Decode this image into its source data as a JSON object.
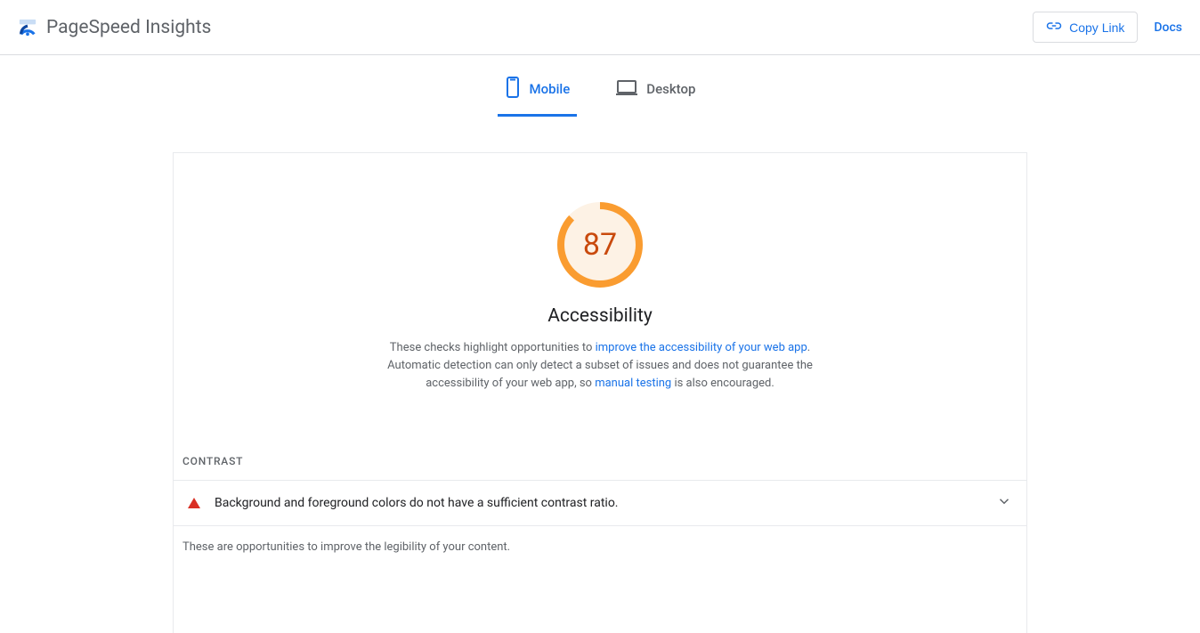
{
  "header": {
    "title": "PageSpeed Insights",
    "copy_link_label": "Copy Link",
    "docs_label": "Docs"
  },
  "tabs": {
    "mobile": "Mobile",
    "desktop": "Desktop"
  },
  "gauge": {
    "score": "87",
    "title": "Accessibility",
    "desc_part1": "These checks highlight opportunities to ",
    "link1": "improve the accessibility of your web app",
    "desc_part2": ". Automatic detection can only detect a subset of issues and does not guarantee the accessibility of your web app, so ",
    "link2": "manual testing",
    "desc_part3": " is also encouraged."
  },
  "contrast": {
    "heading": "CONTRAST",
    "audit": "Background and foreground colors do not have a sufficient contrast ratio.",
    "note": "These are opportunities to improve the legibility of your content."
  }
}
